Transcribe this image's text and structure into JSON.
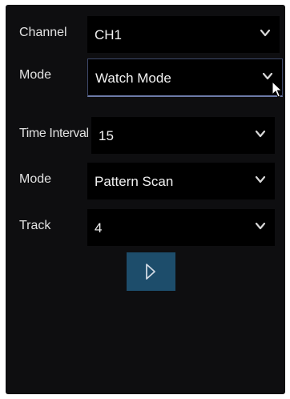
{
  "form": {
    "channel": {
      "label": "Channel",
      "value": "CH1"
    },
    "mode": {
      "label": "Mode",
      "value": "Watch Mode"
    },
    "time_interval": {
      "label": "Time Interval",
      "value": "15"
    },
    "scan_mode": {
      "label": "Mode",
      "value": "Pattern Scan"
    },
    "track": {
      "label": "Track",
      "value": "4"
    }
  },
  "icons": {
    "dropdown": "chevron-down-icon",
    "play": "play-icon",
    "cursor": "mouse-pointer-icon"
  },
  "colors": {
    "panel_bg": "#0e0e10",
    "field_bg": "#000000",
    "text": "#e2e2e2",
    "play_button_bg": "#1d4d6b",
    "focus_border": "#6c7aa8"
  }
}
